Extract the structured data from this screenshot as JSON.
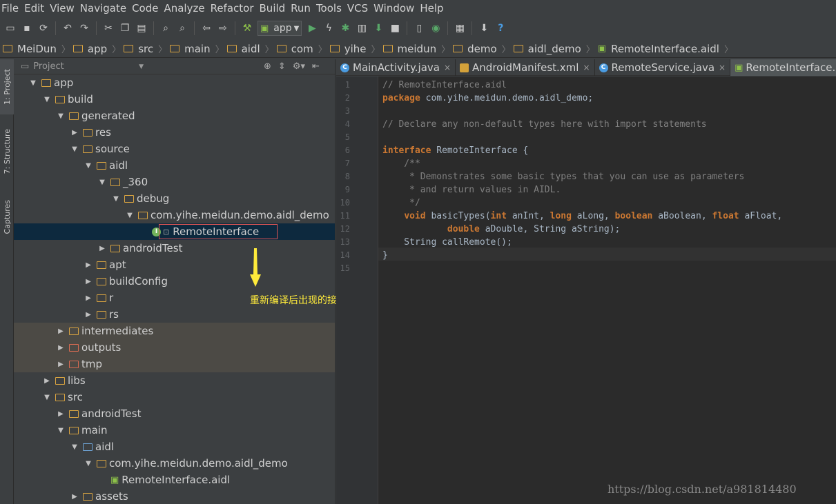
{
  "menu": [
    "File",
    "Edit",
    "View",
    "Navigate",
    "Code",
    "Analyze",
    "Refactor",
    "Build",
    "Run",
    "Tools",
    "VCS",
    "Window",
    "Help"
  ],
  "toolbar": {
    "run_config": "app"
  },
  "breadcrumb": [
    "MeiDun",
    "app",
    "src",
    "main",
    "aidl",
    "com",
    "yihe",
    "meidun",
    "demo",
    "aidl_demo",
    "RemoteInterface.aidl"
  ],
  "left_tabs": {
    "project": "1: Project",
    "structure": "7: Structure",
    "captures": "Captures"
  },
  "project_panel": {
    "title": "Project"
  },
  "tree": [
    {
      "label": "app",
      "depth": 0,
      "open": true,
      "icon": "module"
    },
    {
      "label": "build",
      "depth": 1,
      "open": true,
      "icon": "folder"
    },
    {
      "label": "generated",
      "depth": 2,
      "open": true,
      "icon": "folder"
    },
    {
      "label": "res",
      "depth": 3,
      "open": false,
      "icon": "folder"
    },
    {
      "label": "source",
      "depth": 3,
      "open": true,
      "icon": "folder"
    },
    {
      "label": "aidl",
      "depth": 4,
      "open": true,
      "icon": "folder"
    },
    {
      "label": "_360",
      "depth": 5,
      "open": true,
      "icon": "folder"
    },
    {
      "label": "debug",
      "depth": 6,
      "open": true,
      "icon": "folder"
    },
    {
      "label": "com.yihe.meidun.demo.aidl_demo",
      "depth": 7,
      "open": true,
      "icon": "package"
    },
    {
      "label": "RemoteInterface",
      "depth": 8,
      "open": null,
      "icon": "interface",
      "selected": true
    },
    {
      "label": "androidTest",
      "depth": 5,
      "open": false,
      "icon": "folder"
    },
    {
      "label": "apt",
      "depth": 4,
      "open": false,
      "icon": "folder"
    },
    {
      "label": "buildConfig",
      "depth": 4,
      "open": false,
      "icon": "folder"
    },
    {
      "label": "r",
      "depth": 4,
      "open": false,
      "icon": "folder"
    },
    {
      "label": "rs",
      "depth": 4,
      "open": false,
      "icon": "folder"
    },
    {
      "label": "intermediates",
      "depth": 2,
      "open": false,
      "icon": "folder",
      "excluded": true
    },
    {
      "label": "outputs",
      "depth": 2,
      "open": false,
      "icon": "folder-red",
      "excluded": true
    },
    {
      "label": "tmp",
      "depth": 2,
      "open": false,
      "icon": "folder-red",
      "excluded": true
    },
    {
      "label": "libs",
      "depth": 1,
      "open": false,
      "icon": "folder"
    },
    {
      "label": "src",
      "depth": 1,
      "open": true,
      "icon": "folder"
    },
    {
      "label": "androidTest",
      "depth": 2,
      "open": false,
      "icon": "folder"
    },
    {
      "label": "main",
      "depth": 2,
      "open": true,
      "icon": "folder"
    },
    {
      "label": "aidl",
      "depth": 3,
      "open": true,
      "icon": "folder-blue"
    },
    {
      "label": "com.yihe.meidun.demo.aidl_demo",
      "depth": 4,
      "open": true,
      "icon": "package"
    },
    {
      "label": "RemoteInterface.aidl",
      "depth": 5,
      "open": null,
      "icon": "android"
    },
    {
      "label": "assets",
      "depth": 3,
      "open": false,
      "icon": "folder"
    }
  ],
  "annotation": "重新编译后出现的接口文件",
  "tabs": [
    {
      "label": "MainActivity.java",
      "icon": "class",
      "active": false
    },
    {
      "label": "AndroidManifest.xml",
      "icon": "xml",
      "active": false
    },
    {
      "label": "RemoteService.java",
      "icon": "class",
      "active": false
    },
    {
      "label": "RemoteInterface.aidl",
      "icon": "android",
      "active": true
    }
  ],
  "code_lines": [
    "// RemoteInterface.aidl",
    "package com.yihe.meidun.demo.aidl_demo;",
    "",
    "// Declare any non-default types here with import statements",
    "",
    "interface RemoteInterface {",
    "    /**",
    "     * Demonstrates some basic types that you can use as parameters",
    "     * and return values in AIDL.",
    "     */",
    "    void basicTypes(int anInt, long aLong, boolean aBoolean, float aFloat,",
    "            double aDouble, String aString);",
    "    String callRemote();",
    "}",
    ""
  ],
  "watermark": "https://blog.csdn.net/a981814480",
  "colors": {
    "keyword": "#cc7832",
    "comment": "#808080",
    "text": "#a9b7c6",
    "annotation": "#ffeb3b",
    "highlight_box": "#e05555"
  }
}
